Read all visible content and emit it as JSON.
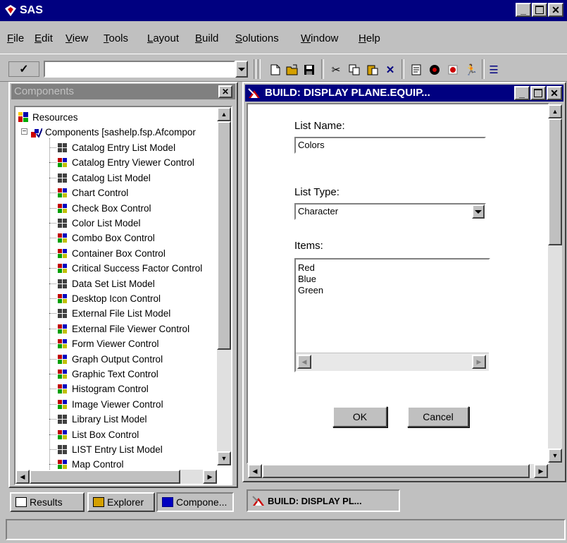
{
  "app": {
    "title": "SAS"
  },
  "menu": [
    "File",
    "Edit",
    "View",
    "Tools",
    "Layout",
    "Build",
    "Solutions",
    "Window",
    "Help"
  ],
  "command": {
    "check": "✓",
    "value": ""
  },
  "components": {
    "title": "Components",
    "root": "Resources",
    "catalog": "Components [sashelp.fsp.Afcompor",
    "items": [
      {
        "label": "Catalog Entry List Model",
        "kind": "model"
      },
      {
        "label": "Catalog Entry Viewer Control",
        "kind": "control"
      },
      {
        "label": "Catalog List Model",
        "kind": "model"
      },
      {
        "label": "Chart Control",
        "kind": "control"
      },
      {
        "label": "Check Box Control",
        "kind": "control"
      },
      {
        "label": "Color List Model",
        "kind": "model"
      },
      {
        "label": "Combo Box Control",
        "kind": "control"
      },
      {
        "label": "Container Box Control",
        "kind": "control"
      },
      {
        "label": "Critical Success Factor Control",
        "kind": "control"
      },
      {
        "label": "Data Set List Model",
        "kind": "model"
      },
      {
        "label": "Desktop Icon Control",
        "kind": "control"
      },
      {
        "label": "External File List Model",
        "kind": "model"
      },
      {
        "label": "External File Viewer Control",
        "kind": "control"
      },
      {
        "label": "Form Viewer Control",
        "kind": "control"
      },
      {
        "label": "Graph Output Control",
        "kind": "control"
      },
      {
        "label": "Graphic Text Control",
        "kind": "control"
      },
      {
        "label": "Histogram Control",
        "kind": "control"
      },
      {
        "label": "Image Viewer Control",
        "kind": "control"
      },
      {
        "label": "Library List Model",
        "kind": "model"
      },
      {
        "label": "List Box Control",
        "kind": "control"
      },
      {
        "label": "LIST Entry List Model",
        "kind": "model"
      },
      {
        "label": "Map Control",
        "kind": "control"
      }
    ]
  },
  "build": {
    "title": "BUILD: DISPLAY PLANE.EQUIP...",
    "list_name_label": "List Name:",
    "list_name_value": "Colors",
    "list_type_label": "List Type:",
    "list_type_value": "Character",
    "items_label": "Items:",
    "items": [
      "Red",
      "Blue",
      "Green"
    ],
    "ok_label": "OK",
    "cancel_label": "Cancel"
  },
  "tabs": {
    "results": "Results",
    "explorer": "Explorer",
    "components": "Compone..."
  },
  "taskbar": {
    "build_label": "BUILD: DISPLAY PL..."
  },
  "colors": {
    "titlebar": "#000080",
    "inactive_title": "#808080",
    "face": "#c0c0c0"
  }
}
